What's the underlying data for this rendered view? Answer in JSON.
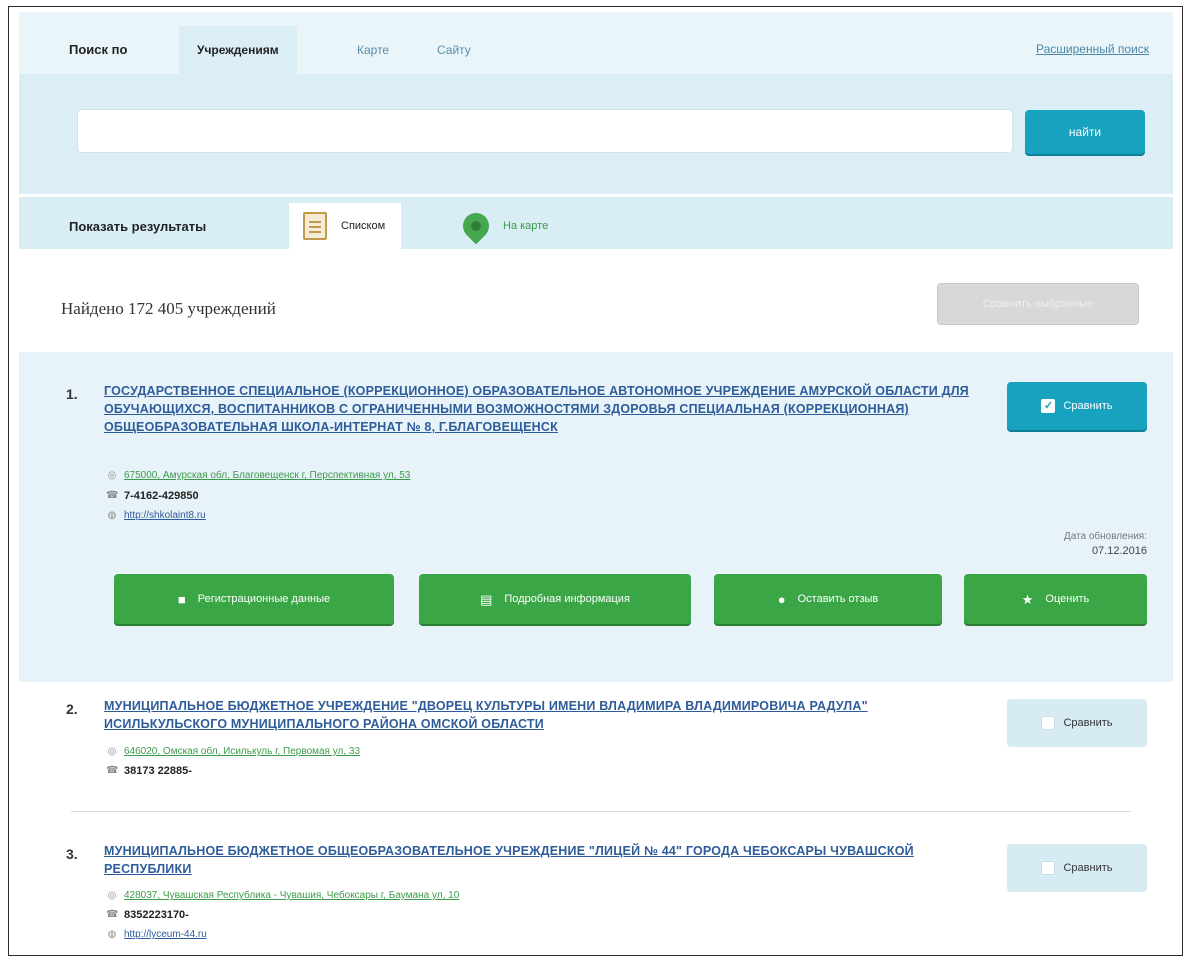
{
  "search": {
    "label": "Поиск по",
    "tabs": [
      {
        "label": "Учреждениям",
        "active": true
      },
      {
        "label": "Карте",
        "active": false
      },
      {
        "label": "Сайту",
        "active": false
      }
    ],
    "advanced_link": "Расширенный поиск",
    "input_value": "",
    "input_placeholder": "",
    "button_label": "найти"
  },
  "view": {
    "label": "Показать результаты",
    "list_label": "Списком",
    "map_label": "На карте"
  },
  "results_header": {
    "found_text": "Найдено 172 405 учреждений",
    "compare_all_label": "Сравнить выбранные"
  },
  "colors": {
    "accent": "#17a2bf",
    "green": "#3aa646",
    "link": "#2e5c9a",
    "highlight_bg": "#e7f3f8"
  },
  "results": [
    {
      "number": "1.",
      "title": "ГОСУДАРСТВЕННОЕ СПЕЦИАЛЬНОЕ (КОРРЕКЦИОННОЕ) ОБРАЗОВАТЕЛЬНОЕ АВТОНОМНОЕ УЧРЕЖДЕНИЕ АМУРСКОЙ ОБЛАСТИ ДЛЯ ОБУЧАЮЩИХСЯ, ВОСПИТАННИКОВ С ОГРАНИЧЕННЫМИ ВОЗМОЖНОСТЯМИ ЗДОРОВЬЯ СПЕЦИАЛЬНАЯ (КОРРЕКЦИОННАЯ) ОБЩЕОБРАЗОВАТЕЛЬНАЯ ШКОЛА-ИНТЕРНАТ № 8, Г.БЛАГОВЕЩЕНСК",
      "address": "675000, Амурская обл, Благовещенск г, Перспективная ул, 53",
      "phone": "7-4162-429850",
      "website": "http://shkolaint8.ru",
      "compare_label": "Сравнить",
      "compare_checked": true,
      "updated_label": "Дата обновления:",
      "updated_date": "07.12.2016",
      "actions": [
        "Регистрационные данные",
        "Подробная информация",
        "Оставить отзыв",
        "Оценить"
      ]
    },
    {
      "number": "2.",
      "title": "МУНИЦИПАЛЬНОЕ БЮДЖЕТНОЕ УЧРЕЖДЕНИЕ \"ДВОРЕЦ КУЛЬТУРЫ ИМЕНИ ВЛАДИМИРА ВЛАДИМИРОВИЧА РАДУЛА\" ИСИЛЬКУЛЬСКОГО МУНИЦИПАЛЬНОГО РАЙОНА ОМСКОЙ ОБЛАСТИ",
      "address": "646020, Омская обл, Исилькуль г, Первомая ул, 33",
      "phone": "38173 22885-",
      "compare_label": "Сравнить",
      "compare_checked": false
    },
    {
      "number": "3.",
      "title": "МУНИЦИПАЛЬНОЕ БЮДЖЕТНОЕ ОБЩЕОБРАЗОВАТЕЛЬНОЕ УЧРЕЖДЕНИЕ \"ЛИЦЕЙ № 44\" ГОРОДА ЧЕБОКСАРЫ ЧУВАШСКОЙ РЕСПУБЛИКИ",
      "address": "428037, Чувашская Республика - Чувашия, Чебоксары г, Баумана ул, 10",
      "phone": "8352223170-",
      "website": "http://lyceum-44.ru",
      "compare_label": "Сравнить",
      "compare_checked": false
    }
  ]
}
